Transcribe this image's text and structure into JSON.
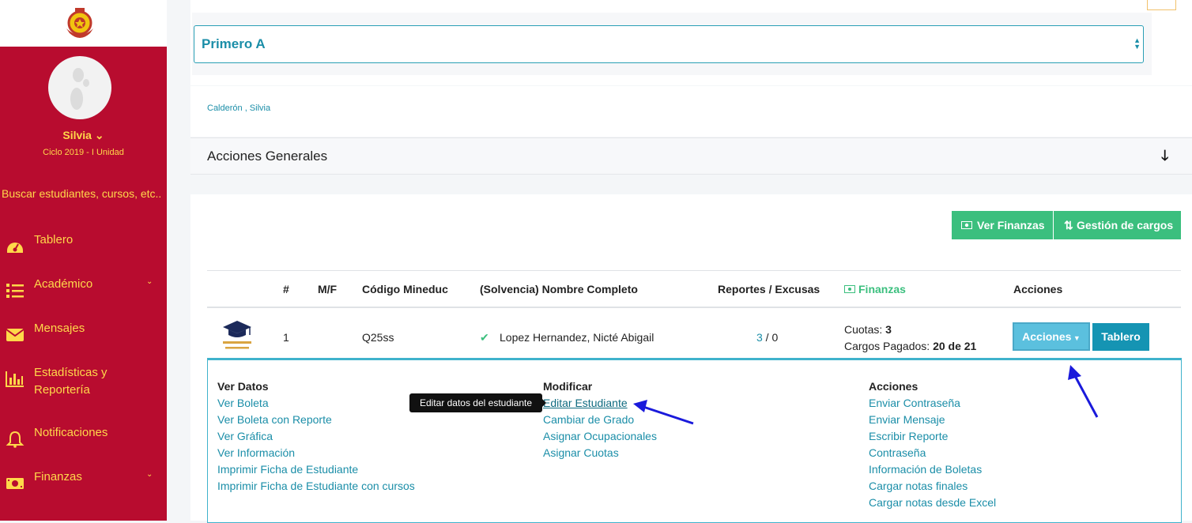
{
  "sidebar": {
    "user_name": "Silvia",
    "cycle": "Ciclo 2019 - I Unidad",
    "search_placeholder": "Buscar estudiantes, cursos, etc..",
    "items": [
      {
        "label": "Tablero",
        "icon": "dashboard-icon"
      },
      {
        "label": "Académico",
        "icon": "list-icon"
      },
      {
        "label": "Mensajes",
        "icon": "envelope-icon"
      },
      {
        "label": "Estadísticas y",
        "label2": "Reportería",
        "icon": "bar-chart-icon"
      },
      {
        "label": "Notificaciones",
        "icon": "bell-icon"
      },
      {
        "label": "Finanzas",
        "icon": "money-icon"
      }
    ],
    "colors": {
      "bg": "#b80c2f",
      "text": "#ffd84a"
    }
  },
  "course_select": {
    "value": "Primero A"
  },
  "teacher": "Calderón , Silvia",
  "accordion": {
    "title": "Acciones Generales"
  },
  "buttons": {
    "ver_finanzas": "Ver Finanzas",
    "gestion_cargos": "Gestión de cargos"
  },
  "table": {
    "headers": [
      "#",
      "M/F",
      "Código Mineduc",
      "(Solvencia) Nombre Completo",
      "Reportes / Excusas",
      "Finanzas",
      "Acciones"
    ],
    "row": {
      "num": "1",
      "mf": "",
      "codigo": "Q25ss",
      "nombre": "Lopez Hernandez, Nicté Abigail",
      "reportes": "3",
      "excusas": " / 0",
      "cuotas_label": "Cuotas: ",
      "cuotas_value": "3",
      "cargos_label": "Cargos Pagados: ",
      "cargos_value": "20 de 21",
      "acciones_btn": "Acciones",
      "tablero_btn": "Tablero"
    }
  },
  "panel": {
    "ver_datos": {
      "title": "Ver Datos",
      "links": [
        "Ver Boleta",
        "Ver Boleta con Reporte",
        "Ver Gráfica",
        "Ver Información",
        "Imprimir Ficha de Estudiante",
        "Imprimir Ficha de Estudiante con cursos"
      ]
    },
    "modificar": {
      "title": "Modificar",
      "links": [
        "Editar Estudiante",
        "Cambiar de Grado",
        "Asignar Ocupacionales",
        "Asignar Cuotas"
      ]
    },
    "acciones": {
      "title": "Acciones",
      "links": [
        "Enviar Contraseña",
        "Enviar Mensaje",
        "Escribir Reporte",
        "Contraseña",
        "Información de Boletas",
        "Cargar notas finales",
        "Cargar notas desde Excel"
      ]
    },
    "tooltip": "Editar datos del estudiante"
  },
  "colors": {
    "accent": "#1b8ea8",
    "green": "#3bbf7e",
    "annotation": "#1a1adb"
  }
}
